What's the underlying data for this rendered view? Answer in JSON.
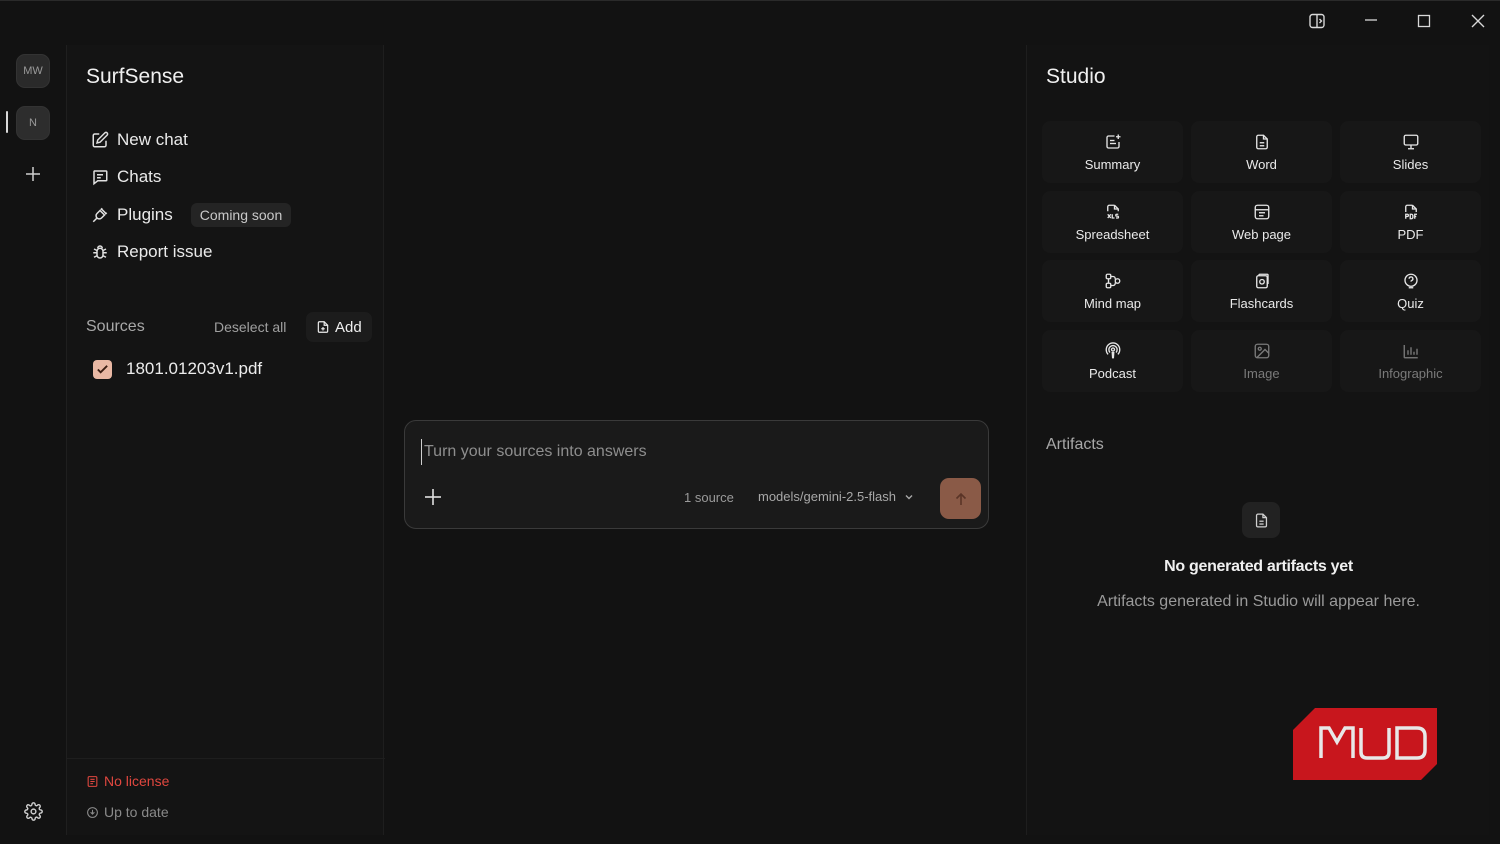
{
  "window": {
    "controls": [
      "split-view-icon",
      "minimize-icon",
      "maximize-icon",
      "close-icon"
    ]
  },
  "rail": {
    "workspaces": [
      "MW",
      "N"
    ],
    "active": "N"
  },
  "sidebar": {
    "title": "SurfSense",
    "nav": [
      {
        "label": "New chat",
        "icon": "edit-icon"
      },
      {
        "label": "Chats",
        "icon": "chat-icon"
      },
      {
        "label": "Plugins",
        "icon": "plug-icon",
        "badge": "Coming soon"
      },
      {
        "label": "Report issue",
        "icon": "bug-icon"
      }
    ],
    "sources": {
      "label": "Sources",
      "deselect_label": "Deselect all",
      "add_label": "Add",
      "items": [
        {
          "name": "1801.01203v1.pdf",
          "checked": true
        }
      ]
    },
    "footer": {
      "license": "No license",
      "update": "Up to date"
    }
  },
  "composer": {
    "placeholder": "Turn your sources into answers",
    "source_count": "1 source",
    "model": "models/gemini-2.5-flash"
  },
  "studio": {
    "title": "Studio",
    "tools": [
      {
        "label": "Summary",
        "icon": "summary-icon",
        "enabled": true
      },
      {
        "label": "Word",
        "icon": "document-icon",
        "enabled": true
      },
      {
        "label": "Slides",
        "icon": "presentation-icon",
        "enabled": true
      },
      {
        "label": "Spreadsheet",
        "icon": "xls-file-icon",
        "enabled": true
      },
      {
        "label": "Web page",
        "icon": "webpage-icon",
        "enabled": true
      },
      {
        "label": "PDF",
        "icon": "pdf-file-icon",
        "enabled": true
      },
      {
        "label": "Mind map",
        "icon": "mind-map-icon",
        "enabled": true
      },
      {
        "label": "Flashcards",
        "icon": "flashcards-icon",
        "enabled": true
      },
      {
        "label": "Quiz",
        "icon": "quiz-icon",
        "enabled": true
      },
      {
        "label": "Podcast",
        "icon": "podcast-icon",
        "enabled": true
      },
      {
        "label": "Image",
        "icon": "image-icon",
        "enabled": false
      },
      {
        "label": "Infographic",
        "icon": "infographic-icon",
        "enabled": false
      }
    ],
    "artifacts_label": "Artifacts",
    "empty_title": "No generated artifacts yet",
    "empty_subtitle": "Artifacts generated in Studio will appear here."
  },
  "watermark": "MUO",
  "colors": {
    "accent": "#8a5a47",
    "checkbox": "#e9b8a4",
    "license_error": "#e0473f",
    "watermark_red": "#c8161d"
  }
}
